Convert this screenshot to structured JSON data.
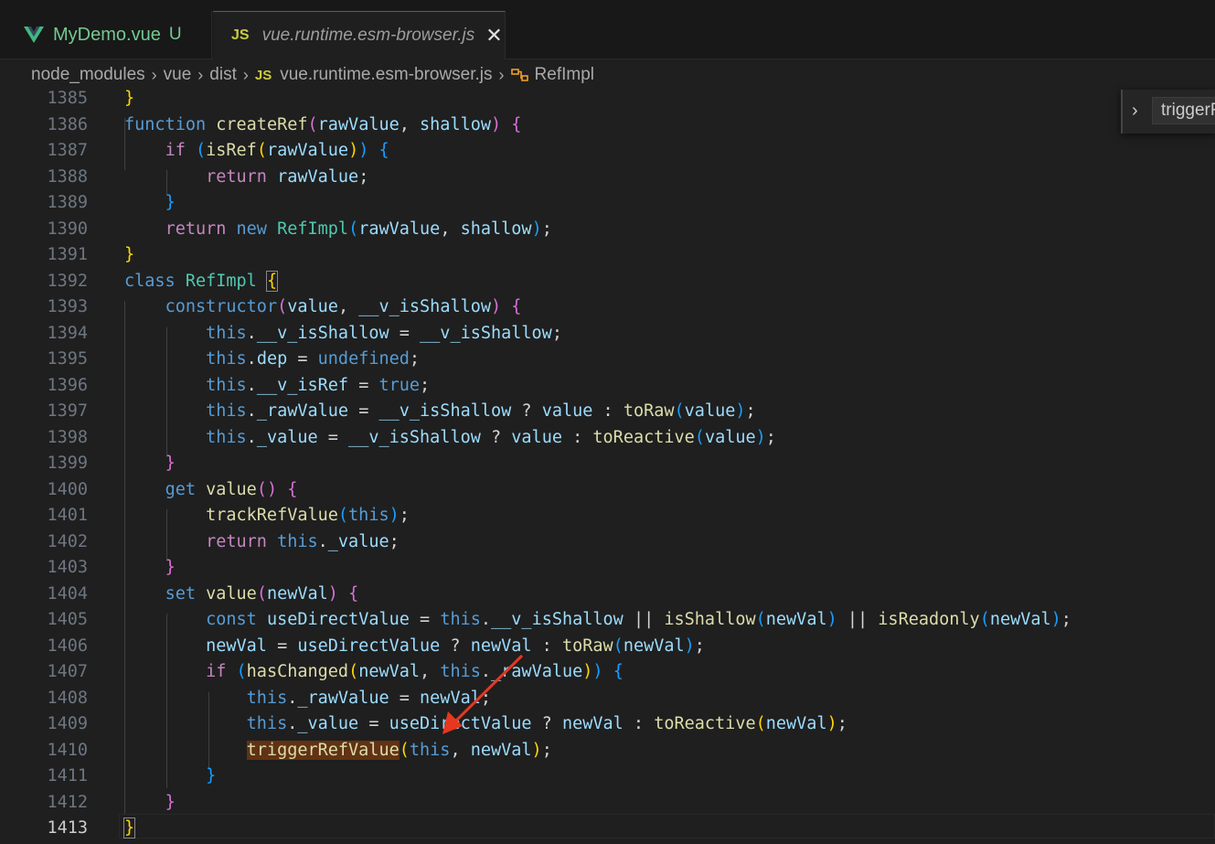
{
  "tabs": [
    {
      "label": "MyDemo.vue",
      "status": "U",
      "icon": "vue-icon"
    },
    {
      "label": "vue.runtime.esm-browser.js",
      "icon": "js-icon",
      "icon_text": "JS",
      "close": "✕"
    }
  ],
  "breadcrumb": {
    "items": [
      "node_modules",
      "vue",
      "dist",
      "vue.runtime.esm-browser.js",
      "RefImpl"
    ],
    "file_icon_text": "JS",
    "separator": "›"
  },
  "find_widget": {
    "value": "triggerR",
    "toggle": "›"
  },
  "editor": {
    "line_numbers": [
      "1385",
      "1386",
      "1387",
      "1388",
      "1389",
      "1390",
      "1391",
      "1392",
      "1393",
      "1394",
      "1395",
      "1396",
      "1397",
      "1398",
      "1399",
      "1400",
      "1401",
      "1402",
      "1403",
      "1404",
      "1405",
      "1406",
      "1407",
      "1408",
      "1409",
      "1410",
      "1411",
      "1412",
      "1413"
    ],
    "active_line": "1413"
  },
  "colors": {
    "background": "#1f1f1f",
    "keyword": "#569cd6",
    "control": "#c586c0",
    "function": "#dcdcaa",
    "variable": "#9cdcfe",
    "class": "#4ec9b0",
    "match_highlight": "#613214",
    "annotation_arrow": "#e8361f"
  }
}
